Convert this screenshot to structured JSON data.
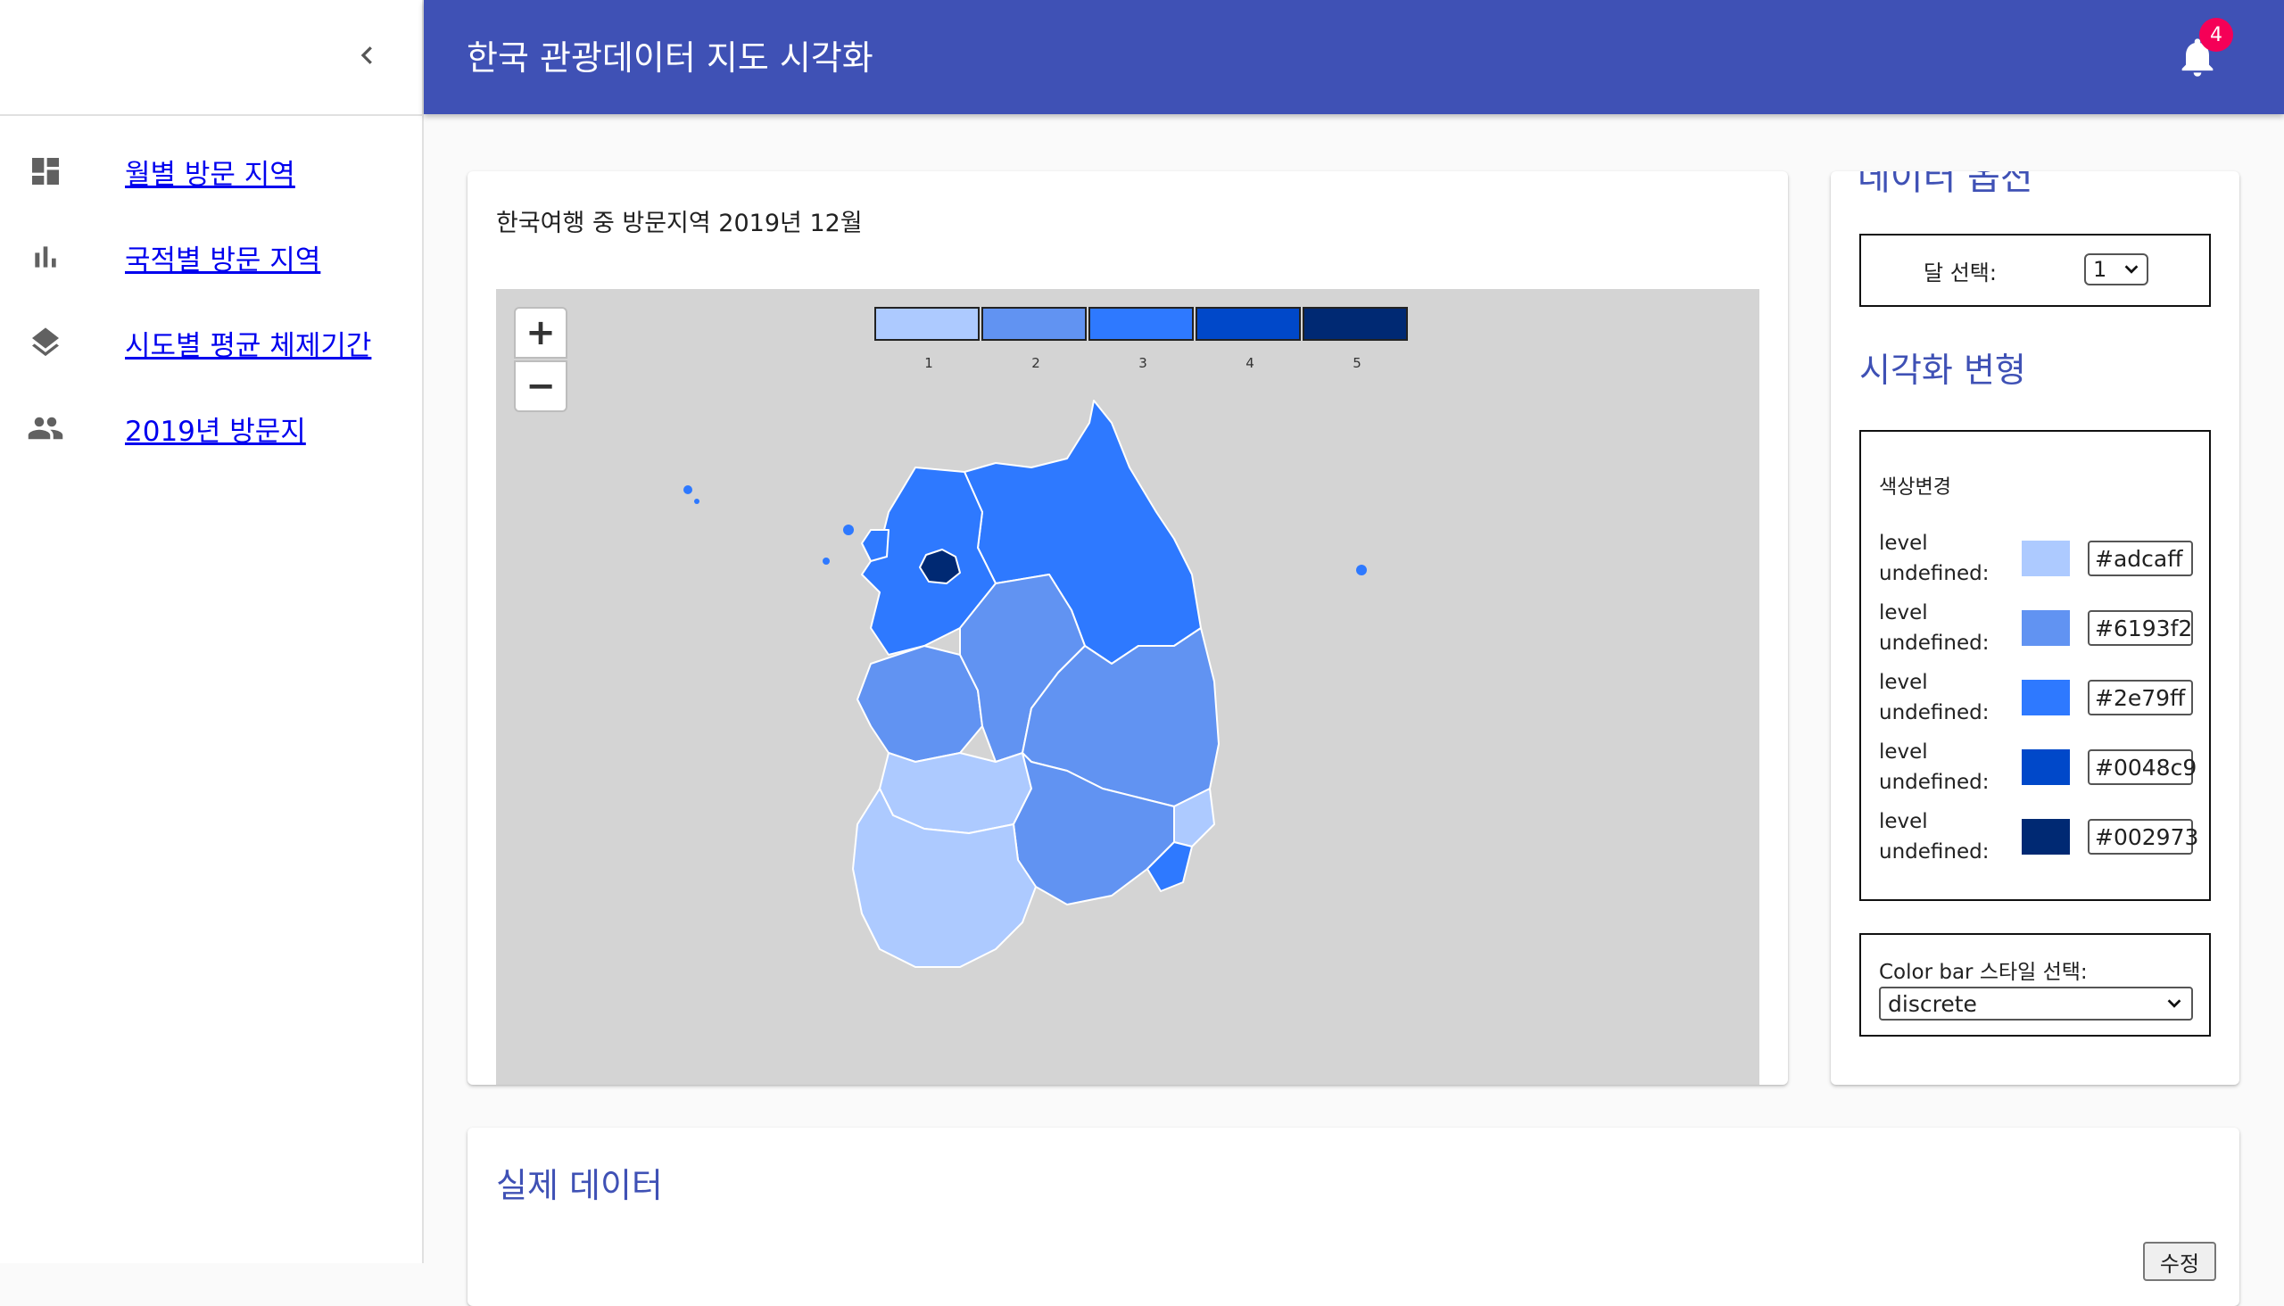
{
  "header": {
    "title": "한국 관광데이터 지도 시각화",
    "notification_count": "4"
  },
  "sidebar": {
    "items": [
      {
        "label": "월별 방문 지역",
        "icon": "dashboard-icon"
      },
      {
        "label": "국적별 방문 지역",
        "icon": "bar-chart-icon"
      },
      {
        "label": "시도별 평균 체제기간",
        "icon": "layers-icon"
      },
      {
        "label": "2019년 방문지",
        "icon": "people-icon"
      }
    ]
  },
  "map": {
    "title": "한국여행 중 방문지역 2019년 12월",
    "zoom_in": "+",
    "zoom_out": "−",
    "legend": [
      {
        "label": "1",
        "color": "#adcaff"
      },
      {
        "label": "2",
        "color": "#6193f2"
      },
      {
        "label": "3",
        "color": "#2e79ff"
      },
      {
        "label": "4",
        "color": "#0048c9"
      },
      {
        "label": "5",
        "color": "#002973"
      }
    ]
  },
  "options": {
    "title": "데이터 옵션",
    "month_label": "달 선택:",
    "month_value": "1",
    "vis_title": "시각화 변형",
    "color_heading": "색상변경",
    "levels": [
      {
        "label": "level undefined:",
        "color": "#adcaff"
      },
      {
        "label": "level undefined:",
        "color": "#6193f2"
      },
      {
        "label": "level undefined:",
        "color": "#2e79ff"
      },
      {
        "label": "level undefined:",
        "color": "#0048c9"
      },
      {
        "label": "level undefined:",
        "color": "#002973"
      }
    ],
    "style_label": "Color bar 스타일 선택:",
    "style_value": "discrete"
  },
  "data_section": {
    "title": "실제 데이터",
    "edit_button": "수정"
  }
}
